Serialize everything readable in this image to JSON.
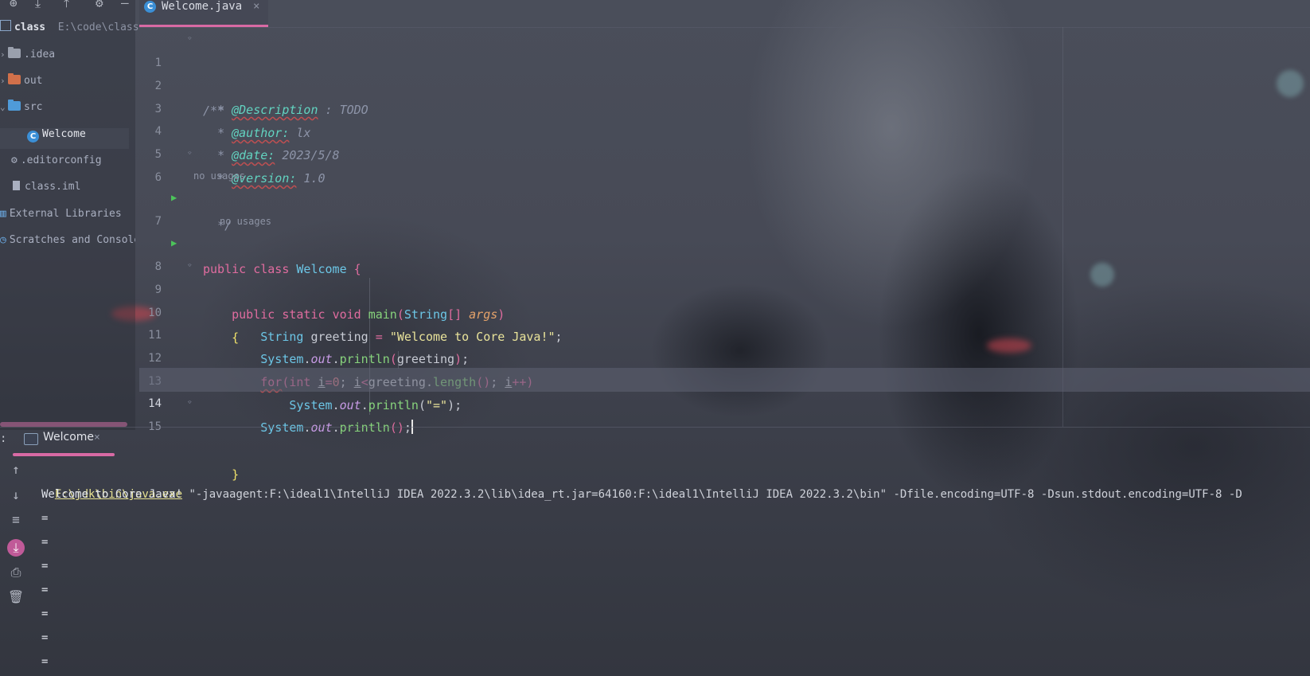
{
  "sidebar": {
    "toolbar_icons": [
      "add-icon",
      "collapse-all-icon",
      "expand-all-icon",
      "gear-icon",
      "minimize-icon"
    ],
    "project_name": "class",
    "project_path": "E:\\code\\class",
    "items": [
      {
        "label": ".idea",
        "icon": "folder-icon",
        "color": "#9aa0ad"
      },
      {
        "label": "out",
        "icon": "folder-icon",
        "color": "#d1704a"
      },
      {
        "label": "src",
        "icon": "folder-icon",
        "color": "#4f9bd9"
      },
      {
        "label": "Welcome",
        "icon": "java-class-icon"
      },
      {
        "label": ".editorconfig",
        "icon": "gear-icon"
      },
      {
        "label": "class.iml",
        "icon": "file-icon"
      },
      {
        "label": "External Libraries",
        "icon": "library-icon"
      },
      {
        "label": "Scratches and Consoles",
        "icon": "scratch-icon"
      }
    ]
  },
  "editor": {
    "tab_label": "Welcome.java",
    "hint_no_usages": "no usages",
    "line_numbers": [
      "1",
      "2",
      "3",
      "4",
      "5",
      "6",
      "7",
      "8",
      "9",
      "10",
      "11",
      "12",
      "13",
      "14",
      "15"
    ],
    "javadoc": {
      "open": "/**",
      "star": "*",
      "description_tag": "@Description",
      "description_value": " : TODO",
      "author_tag": "@author:",
      "author_value": " lx",
      "date_tag": "@date:",
      "date_value": " 2023/5/8",
      "version_tag": "@version:",
      "version_value": " 1.0",
      "close": "*/"
    },
    "code": {
      "kw_public": "public",
      "kw_class": "class",
      "class_name": "Welcome",
      "kw_static": "static",
      "kw_void": "void",
      "method_main": "main",
      "type_string": "String",
      "array_brackets": "[]",
      "param_args": "args",
      "var_greeting": "greeting",
      "string_literal": "\"Welcome to Core Java!\"",
      "system": "System",
      "field_out": "out",
      "method_println": "println",
      "kw_for": "for",
      "kw_int": "int",
      "var_i": "i",
      "zero": "0",
      "method_length": "length",
      "eq_literal": "\"=\""
    }
  },
  "run_panel": {
    "colon": ":",
    "tab_label": "Welcome",
    "tool_icons": [
      "up-arrow-icon",
      "down-arrow-icon",
      "soft-wrap-icon",
      "scroll-to-end-icon",
      "print-icon",
      "trash-icon"
    ],
    "command_exe": "F:\\jdk\\bin\\java.exe",
    "command_args": " \"-javaagent:F:\\ideal1\\IntelliJ IDEA 2022.3.2\\lib\\idea_rt.jar=64160:F:\\ideal1\\IntelliJ IDEA 2022.3.2\\bin\" -Dfile.encoding=UTF-8 -Dsun.stdout.encoding=UTF-8 -D",
    "output_lines": [
      "Welcome to Core Java!",
      "=",
      "=",
      "=",
      "=",
      "=",
      "=",
      "="
    ]
  }
}
